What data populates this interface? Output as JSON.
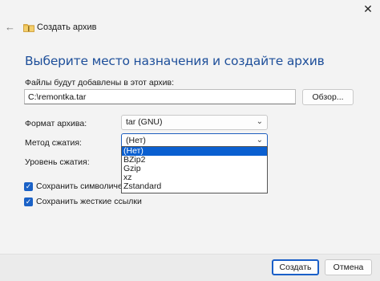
{
  "window": {
    "title": "Создать архив",
    "close_glyph": "✕",
    "back_glyph": "←"
  },
  "heading": "Выберите место назначения и создайте архив",
  "files": {
    "label": "Файлы будут добавлены в этот архив:",
    "path_value": "C:\\remontka.tar",
    "browse_label": "Обзор..."
  },
  "format": {
    "label": "Формат архива:",
    "value": "tar (GNU)"
  },
  "method": {
    "label": "Метод сжатия:",
    "value": "(Нет)",
    "options": [
      "(Нет)",
      "BZip2",
      "Gzip",
      "xz",
      "Zstandard"
    ],
    "selected_index": 0
  },
  "level": {
    "label": "Уровень сжатия:"
  },
  "checkboxes": {
    "symlinks_label": "Сохранить символические ссылки",
    "symlinks_checked": true,
    "hardlinks_label": "Сохранить жесткие ссылки",
    "hardlinks_checked": true
  },
  "footer": {
    "create_label": "Создать",
    "cancel_label": "Отмена"
  },
  "colors": {
    "accent": "#1a61c6",
    "heading": "#1e4f9a",
    "selected_option": "#0a5fd0"
  },
  "icons": {
    "back": "back-arrow-icon",
    "folder": "folder-zip-icon",
    "close": "close-icon",
    "chevron": "chevron-down-icon",
    "check": "checkmark-icon"
  }
}
